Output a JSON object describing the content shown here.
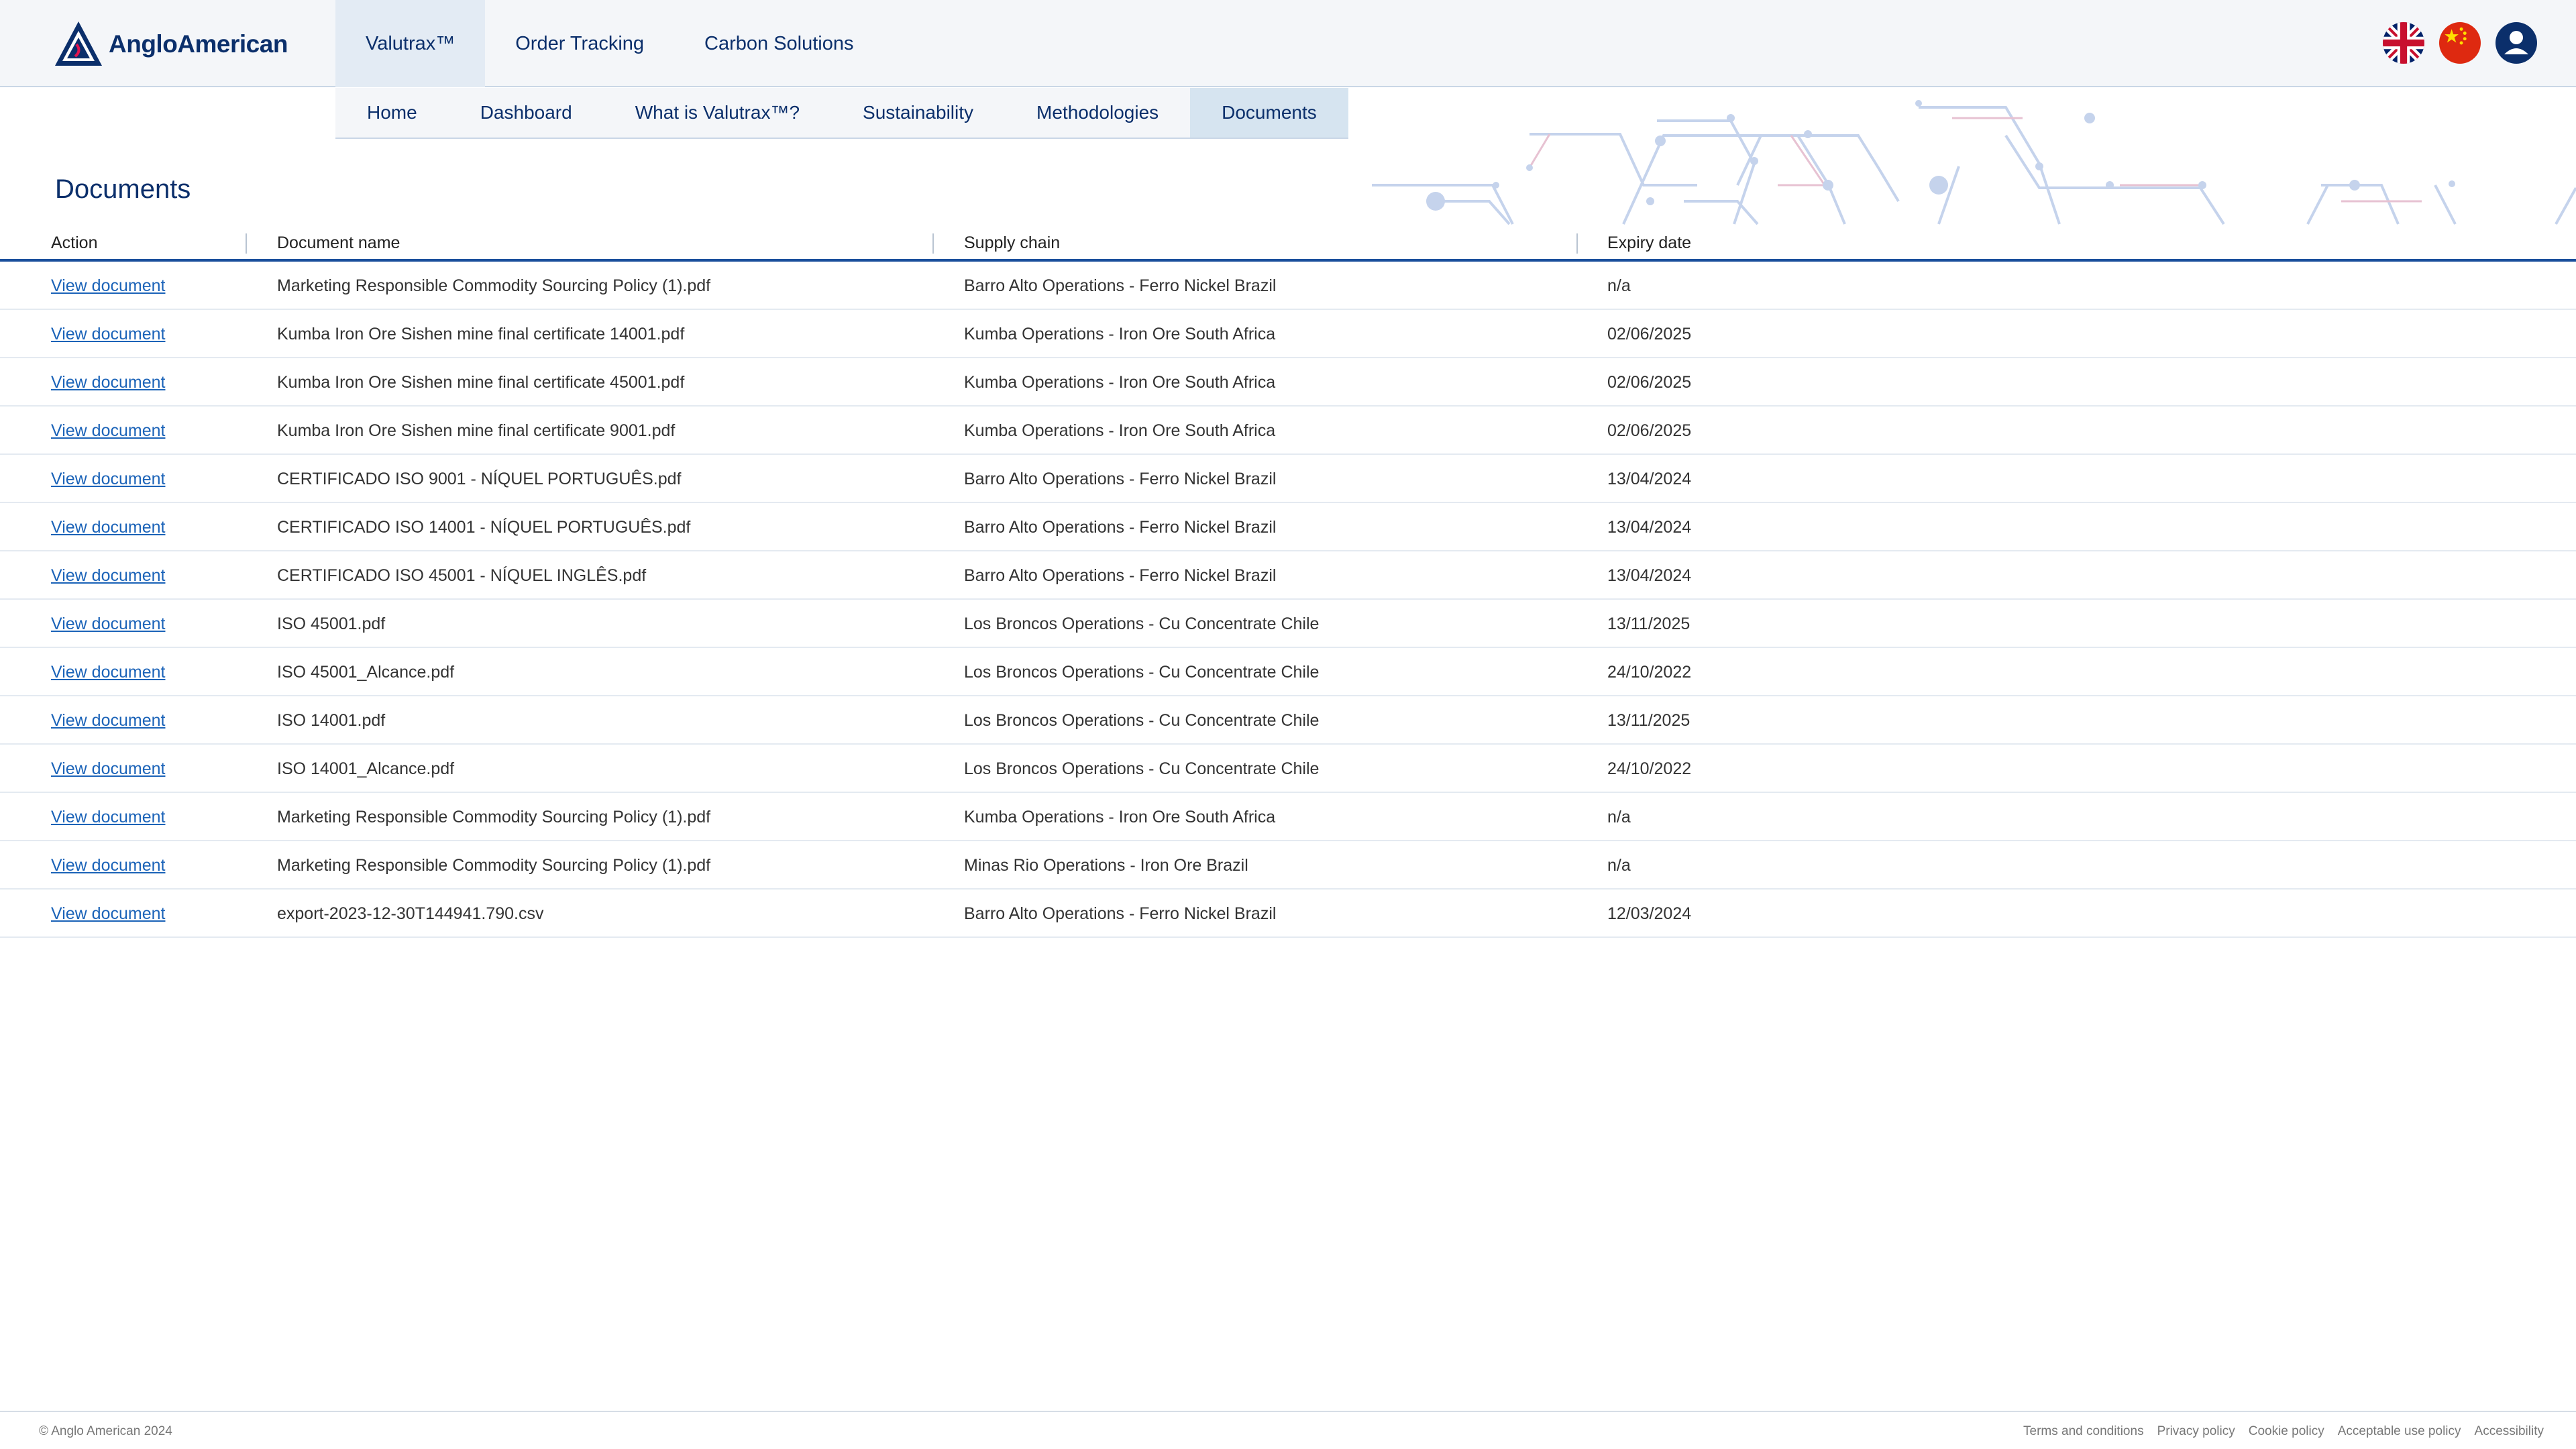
{
  "brand": {
    "name": "AngloAmerican"
  },
  "topnav": [
    {
      "label": "Valutrax™",
      "active": true
    },
    {
      "label": "Order Tracking",
      "active": false
    },
    {
      "label": "Carbon Solutions",
      "active": false
    }
  ],
  "language_icons": [
    "uk-flag-icon",
    "china-flag-icon"
  ],
  "user_icon": "user-account-icon",
  "subnav": [
    {
      "label": "Home",
      "active": false
    },
    {
      "label": "Dashboard",
      "active": false
    },
    {
      "label": "What is Valutrax™?",
      "active": false
    },
    {
      "label": "Sustainability",
      "active": false
    },
    {
      "label": "Methodologies",
      "active": false
    },
    {
      "label": "Documents",
      "active": true
    }
  ],
  "page_title": "Documents",
  "table": {
    "headers": [
      "Action",
      "Document name",
      "Supply chain",
      "Expiry date"
    ],
    "rows": [
      {
        "action": "View document",
        "name": "Marketing Responsible Commodity Sourcing Policy (1).pdf",
        "chain": "Barro Alto Operations - Ferro Nickel Brazil",
        "expiry": "n/a"
      },
      {
        "action": "View document",
        "name": "Kumba Iron Ore Sishen mine final certificate 14001.pdf",
        "chain": "Kumba Operations - Iron Ore South Africa",
        "expiry": "02/06/2025"
      },
      {
        "action": "View document",
        "name": "Kumba Iron Ore Sishen mine final certificate 45001.pdf",
        "chain": "Kumba Operations - Iron Ore South Africa",
        "expiry": "02/06/2025"
      },
      {
        "action": "View document",
        "name": "Kumba Iron Ore Sishen mine final certificate 9001.pdf",
        "chain": "Kumba Operations - Iron Ore South Africa",
        "expiry": "02/06/2025"
      },
      {
        "action": "View document",
        "name": "CERTIFICADO ISO 9001 - NÍQUEL PORTUGUÊS.pdf",
        "chain": "Barro Alto Operations - Ferro Nickel Brazil",
        "expiry": "13/04/2024"
      },
      {
        "action": "View document",
        "name": "CERTIFICADO ISO 14001 - NÍQUEL PORTUGUÊS.pdf",
        "chain": "Barro Alto Operations - Ferro Nickel Brazil",
        "expiry": "13/04/2024"
      },
      {
        "action": "View document",
        "name": "CERTIFICADO ISO 45001 - NÍQUEL INGLÊS.pdf",
        "chain": "Barro Alto Operations - Ferro Nickel Brazil",
        "expiry": "13/04/2024"
      },
      {
        "action": "View document",
        "name": "ISO 45001.pdf",
        "chain": "Los Broncos Operations - Cu Concentrate Chile",
        "expiry": "13/11/2025"
      },
      {
        "action": "View document",
        "name": "ISO 45001_Alcance.pdf",
        "chain": "Los Broncos Operations - Cu Concentrate Chile",
        "expiry": "24/10/2022"
      },
      {
        "action": "View document",
        "name": "ISO 14001.pdf",
        "chain": "Los Broncos Operations - Cu Concentrate Chile",
        "expiry": "13/11/2025"
      },
      {
        "action": "View document",
        "name": "ISO 14001_Alcance.pdf",
        "chain": "Los Broncos Operations - Cu Concentrate Chile",
        "expiry": "24/10/2022"
      },
      {
        "action": "View document",
        "name": "Marketing Responsible Commodity Sourcing Policy (1).pdf",
        "chain": "Kumba Operations - Iron Ore South Africa",
        "expiry": "n/a"
      },
      {
        "action": "View document",
        "name": "Marketing Responsible Commodity Sourcing Policy (1).pdf",
        "chain": "Minas Rio Operations - Iron Ore Brazil",
        "expiry": "n/a"
      },
      {
        "action": "View document",
        "name": "export-2023-12-30T144941.790.csv",
        "chain": "Barro Alto Operations - Ferro Nickel Brazil",
        "expiry": "12/03/2024"
      }
    ]
  },
  "footer": {
    "copyright": "© Anglo American 2024",
    "links": [
      "Terms and conditions",
      "Privacy policy",
      "Cookie policy",
      "Acceptable use policy",
      "Accessibility"
    ]
  },
  "colors": {
    "brand_navy": "#0b2f6b",
    "link_blue": "#1b63b8",
    "header_bg": "#f4f6f9",
    "active_tab": "#d6e4f0",
    "table_rule": "#1a4f9c"
  }
}
